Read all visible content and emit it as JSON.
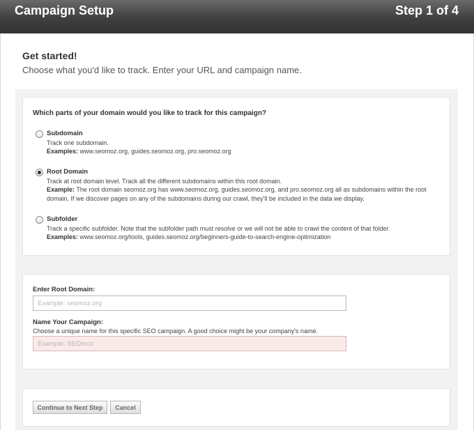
{
  "header": {
    "title": "Campaign Setup",
    "step": "Step 1 of 4"
  },
  "intro": {
    "heading": "Get started!",
    "subheading": "Choose what you'd like to track. Enter your URL and campaign name."
  },
  "scope": {
    "question": "Which parts of your domain would you like to track for this campaign?",
    "selected": "root_domain",
    "options": {
      "subdomain": {
        "name": "Subdomain",
        "description": "Track one subdomain.",
        "examples_label": "Examples:",
        "examples": " www.seomoz.org, guides.seomoz.org, pro.seomoz.org"
      },
      "root_domain": {
        "name": "Root Domain",
        "description": "Track at root domain level. Track all the different subdomains within this root domain.",
        "examples_label": "Example:",
        "examples": " The root domain seomoz.org has www.seomoz.org, guides.seomoz.org, and pro.seomoz.org all as subdomains within the root domain. If we discover pages on any of the subdomains during our crawl, they'll be included in the data we display."
      },
      "subfolder": {
        "name": "Subfolder",
        "description": "Track a specific subfolder. Note that the subfolder path must resolve or we will not be able to crawl the content of that folder.",
        "examples_label": "Examples:",
        "examples": " www.seomoz.org/tools, guides.seomoz.org/beginners-guide-to-search-engine-optimization"
      }
    }
  },
  "fields": {
    "root_domain": {
      "label": "Enter Root Domain:",
      "value": "",
      "placeholder": "Example: seomoz.org"
    },
    "campaign_name": {
      "label": "Name Your Campaign:",
      "help": "Choose a unique name for this specific SEO campaign. A good choice might be your company's name.",
      "value": "",
      "placeholder": "Example: SEOmoz"
    }
  },
  "actions": {
    "continue_label": "Continue to Next Step",
    "cancel_label": "Cancel"
  },
  "colors": {
    "header_bg": "#3f3f3f",
    "panel_bg": "#f2f2f2",
    "error_field_bg": "#fbeaea"
  }
}
